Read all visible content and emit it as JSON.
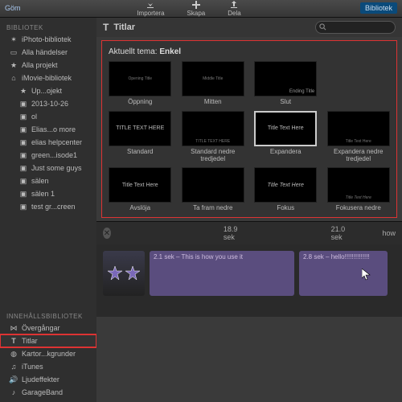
{
  "toolbar": {
    "hide": "Göm",
    "import": "Importera",
    "create": "Skapa",
    "share": "Dela",
    "library": "Bibliotek"
  },
  "sidebar": {
    "library_head": "BIBLIOTEK",
    "items": [
      {
        "label": "iPhoto-bibliotek"
      },
      {
        "label": "Alla händelser"
      },
      {
        "label": "Alla projekt"
      },
      {
        "label": "iMovie-bibliotek"
      },
      {
        "label": "Up...ojekt"
      },
      {
        "label": "2013-10-26"
      },
      {
        "label": "ol"
      },
      {
        "label": "Elias...o more"
      },
      {
        "label": "elias helpcenter"
      },
      {
        "label": "green...isode1"
      },
      {
        "label": "Just some guys"
      },
      {
        "label": "sälen"
      },
      {
        "label": "sälen 1"
      },
      {
        "label": "test gr...creen"
      }
    ],
    "content_head": "INNEHÅLLSBIBLIOTEK",
    "content_items": [
      {
        "label": "Övergångar"
      },
      {
        "label": "Titlar"
      },
      {
        "label": "Kartor...kgrunder"
      },
      {
        "label": "iTunes"
      },
      {
        "label": "Ljudeffekter"
      },
      {
        "label": "GarageBand"
      }
    ]
  },
  "panel": {
    "header": "Titlar",
    "search_placeholder": "",
    "theme_prefix": "Aktuellt tema: ",
    "theme_name": "Enkel",
    "titles": [
      {
        "caption": "Öppning",
        "preview": "Opening Title"
      },
      {
        "caption": "Mitten",
        "preview": "Middle Title"
      },
      {
        "caption": "Slut",
        "preview": "Ending Title"
      },
      {
        "caption": "",
        "preview": ""
      },
      {
        "caption": "Standard",
        "preview": "TITLE TEXT HERE"
      },
      {
        "caption": "Standard nedre tredjedel",
        "preview": "TITLE TEXT HERE"
      },
      {
        "caption": "Expandera",
        "preview": "Title Text Here"
      },
      {
        "caption": "Expandera nedre tredjedel",
        "preview": "Title Text Here"
      },
      {
        "caption": "Avslöja",
        "preview": "Title Text Here"
      },
      {
        "caption": "Ta fram nedre",
        "preview": ""
      },
      {
        "caption": "Fokus",
        "preview": "Title Text Here"
      },
      {
        "caption": "Fokusera nedre",
        "preview": "Title Text Here"
      }
    ]
  },
  "timeline": {
    "mark1": "18.9 sek",
    "mark2": "21.0 sek",
    "how": "how",
    "clip1": "2.1 sek – This is how you use it",
    "clip2": "2.8 sek – hello!!!!!!!!!!!!!!"
  }
}
